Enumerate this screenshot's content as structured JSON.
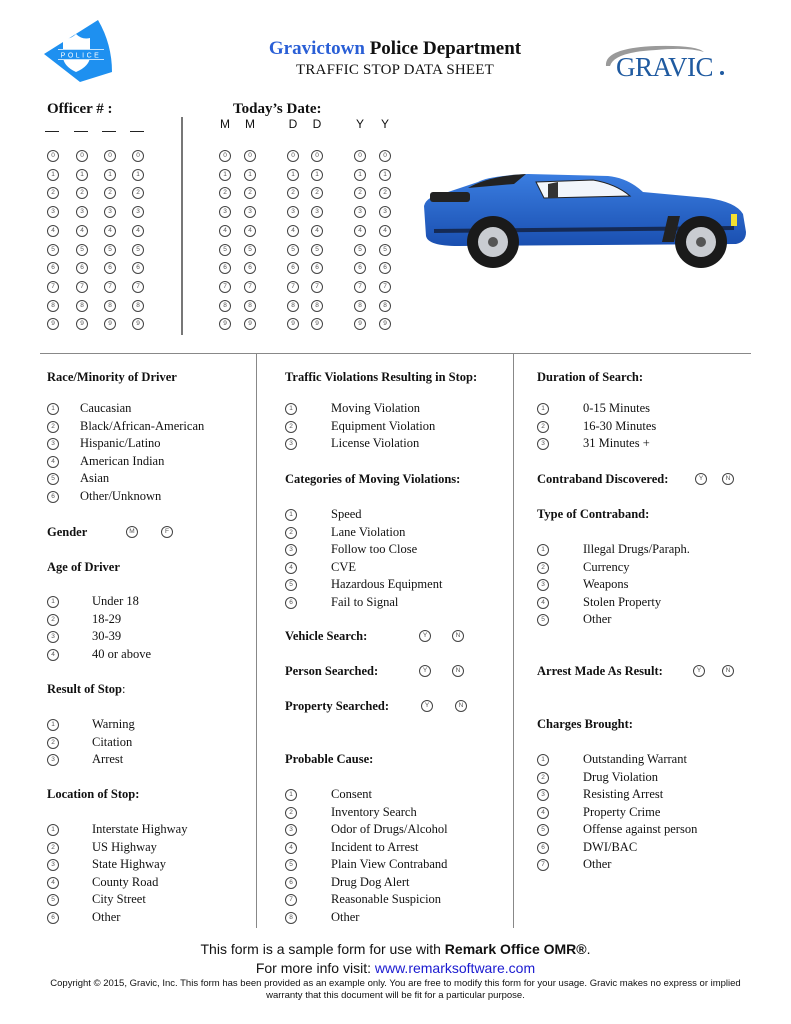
{
  "header": {
    "title_part1": "Gravictown",
    "title_part2": " Police Department",
    "subtitle": "TRAFFIC STOP DATA SHEET",
    "police_logo_text": "POLICE",
    "gravic_logo_text": "GRAVIC",
    "brand_blue": "#2a5fd6",
    "police_blue": "#1e90f0",
    "gravic_blue": "#1f5aa0"
  },
  "officer": {
    "label": "Officer # :",
    "columns": 4,
    "digits": [
      "0",
      "1",
      "2",
      "3",
      "4",
      "5",
      "6",
      "7",
      "8",
      "9"
    ]
  },
  "date": {
    "label": "Today’s Date:",
    "column_labels": [
      "M",
      "M",
      "D",
      "D",
      "Y",
      "Y"
    ],
    "digits": [
      "0",
      "1",
      "2",
      "3",
      "4",
      "5",
      "6",
      "7",
      "8",
      "9"
    ]
  },
  "sections": {
    "race": {
      "title": "Race/Minority of Driver",
      "options": [
        "Caucasian",
        "Black/African-American",
        "Hispanic/Latino",
        "American Indian",
        "Asian",
        "Other/Unknown"
      ]
    },
    "gender": {
      "title": "Gender",
      "options": [
        "M",
        "F"
      ]
    },
    "age": {
      "title": "Age of Driver",
      "options": [
        "Under 18",
        "18-29",
        "30-39",
        "40 or above"
      ]
    },
    "result": {
      "title": "Result of Stop",
      "title_suffix": ":",
      "options": [
        "Warning",
        "Citation",
        "Arrest"
      ]
    },
    "location": {
      "title": "Location of Stop:",
      "options": [
        "Interstate Highway",
        "US Highway",
        "State Highway",
        "County Road",
        "City Street",
        "Other"
      ]
    },
    "violations": {
      "title": "Traffic Violations Resulting in Stop:",
      "options": [
        "Moving Violation",
        "Equipment Violation",
        "License Violation"
      ]
    },
    "moving": {
      "title": "Categories of Moving Violations:",
      "options": [
        "Speed",
        "Lane Violation",
        "Follow too Close",
        "CVE",
        "Hazardous Equipment",
        "Fail to Signal"
      ]
    },
    "vehicle_search": {
      "title": "Vehicle Search:",
      "options": [
        "Y",
        "N"
      ]
    },
    "person_searched": {
      "title": "Person Searched:",
      "options": [
        "Y",
        "N"
      ]
    },
    "property_searched": {
      "title": "Property Searched:",
      "options": [
        "Y",
        "N"
      ]
    },
    "probable_cause": {
      "title": "Probable Cause:",
      "options": [
        "Consent",
        "Inventory Search",
        "Odor of Drugs/Alcohol",
        "Incident to Arrest",
        "Plain View Contraband",
        "Drug Dog Alert",
        "Reasonable Suspicion",
        "Other"
      ]
    },
    "duration": {
      "title": "Duration of Search:",
      "options": [
        "0-15 Minutes",
        "16-30 Minutes",
        "31 Minutes +"
      ]
    },
    "contraband_discovered": {
      "title": "Contraband Discovered:",
      "options": [
        "Y",
        "N"
      ]
    },
    "contraband_type": {
      "title": "Type of Contraband:",
      "options": [
        "Illegal Drugs/Paraph.",
        "Currency",
        "Weapons",
        "Stolen Property",
        "Other"
      ]
    },
    "arrest_made": {
      "title": "Arrest Made As Result:",
      "options": [
        "Y",
        "N"
      ]
    },
    "charges": {
      "title": "Charges Brought:",
      "options": [
        "Outstanding Warrant",
        "Drug Violation",
        "Resisting Arrest",
        "Property Crime",
        "Offense against person",
        "DWI/BAC",
        "Other"
      ]
    }
  },
  "footer": {
    "line1_prefix": "This form is a sample form for use with ",
    "line1_bold": "Remark Office OMR®",
    "line1_suffix": ".",
    "line2_prefix": "For more info visit: ",
    "link_text": "www.remarksoftware.com",
    "copyright": "Copyright © 2015, Gravic, Inc. This form has been provided as an example only. You are free to modify this form for your usage. Gravic makes no express or implied warranty that this document will be fit for a particular purpose."
  }
}
